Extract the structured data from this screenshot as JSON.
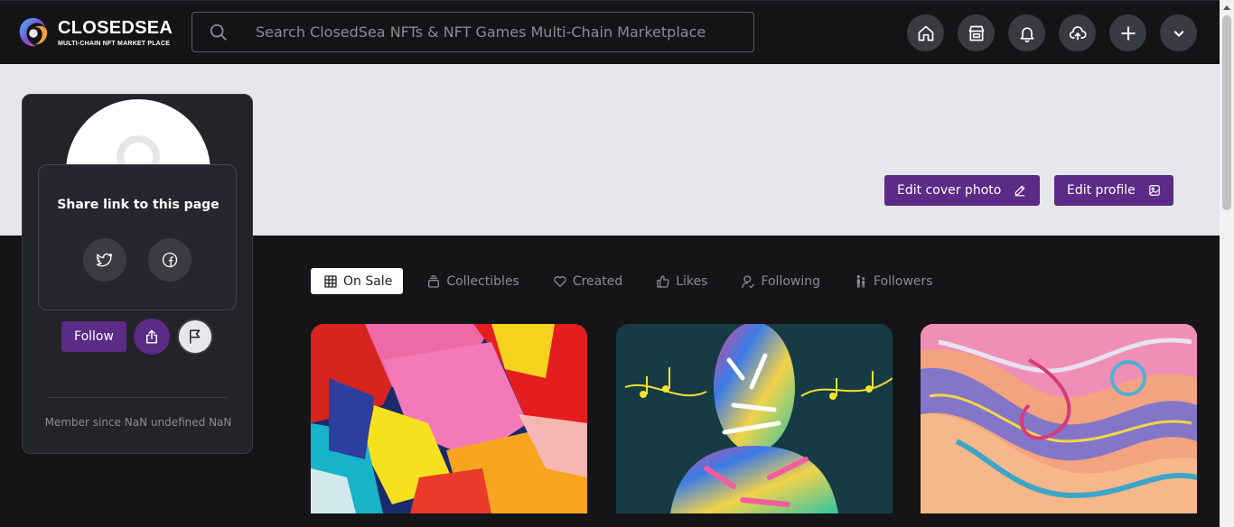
{
  "brand": {
    "name": "CLOSEDSEA",
    "tagline": "MULTI-CHAIN NFT MARKET PLACE",
    "logo_icon": "swirl-logo-icon"
  },
  "search": {
    "placeholder": "Search ClosedSea NFTs & NFT Games Multi-Chain Marketplace",
    "icon": "search-icon"
  },
  "nav": {
    "icons": [
      "home-icon",
      "store-icon",
      "bell-icon",
      "cloud-upload-icon",
      "plus-icon",
      "chevron-down-icon"
    ]
  },
  "cover": {
    "edit_cover_label": "Edit cover photo",
    "edit_profile_label": "Edit profile"
  },
  "profile": {
    "share_title": "Share link to this page",
    "share_icons": [
      "twitter-icon",
      "facebook-icon"
    ],
    "follow_label": "Follow",
    "member_since": "Member since NaN undefined NaN"
  },
  "tabs": [
    {
      "label": "On Sale",
      "icon": "grid-icon",
      "active": true
    },
    {
      "label": "Collectibles",
      "icon": "stack-icon",
      "active": false
    },
    {
      "label": "Created",
      "icon": "heart-icon",
      "active": false
    },
    {
      "label": "Likes",
      "icon": "thumbs-up-icon",
      "active": false
    },
    {
      "label": "Following",
      "icon": "user-icon",
      "active": false
    },
    {
      "label": "Followers",
      "icon": "people-icon",
      "active": false
    }
  ],
  "nft_cards": [
    {
      "image": "abstract-paint-image"
    },
    {
      "image": "painted-face-music-image"
    },
    {
      "image": "marbled-swirl-image"
    }
  ],
  "colors": {
    "header_bg": "#141416",
    "page_bg": "#151517",
    "cover_bg": "#e6e7eb",
    "accent_purple": "#5b2b87",
    "card_bg": "#23232a",
    "muted_text": "#8b8b93"
  }
}
